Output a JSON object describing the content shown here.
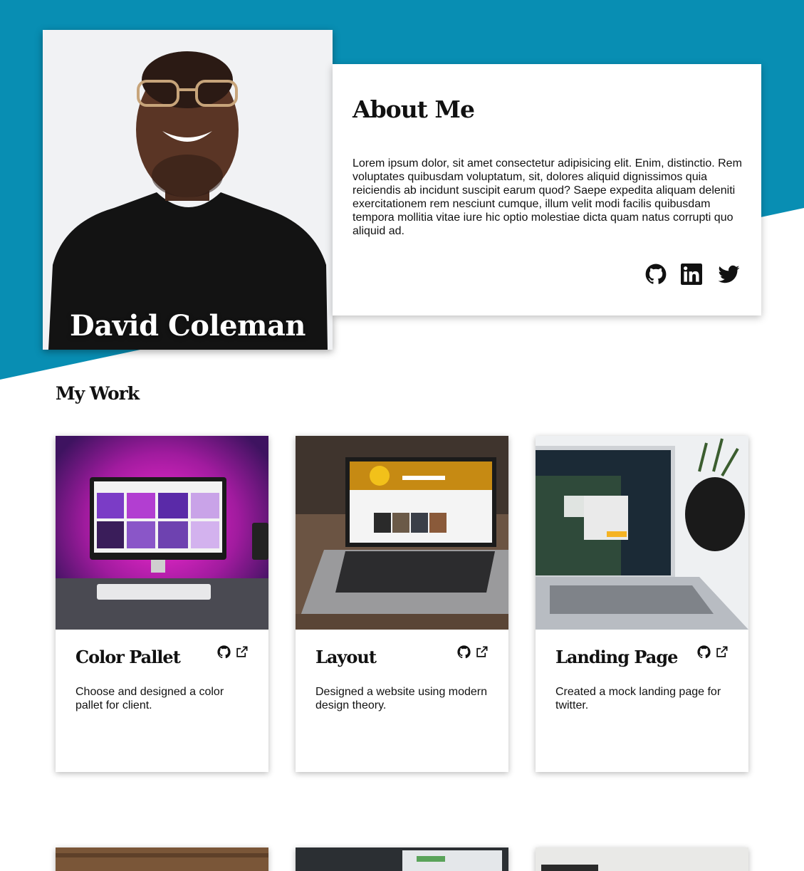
{
  "colors": {
    "hero_accent": "#088eb3",
    "text": "#111111",
    "card_bg": "#ffffff"
  },
  "profile": {
    "name": "David Coleman"
  },
  "about": {
    "title": "About Me",
    "text": "Lorem ipsum dolor, sit amet consectetur adipisicing elit. Enim, distinctio. Rem voluptates quibusdam voluptatum, sit, dolores aliquid dignissimos quia reiciendis ab incidunt suscipit earum quod? Saepe expedita aliquam deleniti exercitationem rem nesciunt cumque, illum velit modi facilis quibusdam tempora mollitia vitae iure hic optio molestiae dicta quam natus corrupti quo aliquid ad.",
    "socials": [
      "github-icon",
      "linkedin-icon",
      "twitter-icon"
    ]
  },
  "work": {
    "title": "My Work",
    "projects": [
      {
        "title": "Color Pallet",
        "description": "Choose and designed a color pallet for client.",
        "icons": [
          "github-icon",
          "external-link-icon"
        ]
      },
      {
        "title": "Layout",
        "description": "Designed a website using modern design theory.",
        "icons": [
          "github-icon",
          "external-link-icon"
        ]
      },
      {
        "title": "Landing Page",
        "description": "Created a mock landing page for twitter.",
        "icons": [
          "github-icon",
          "external-link-icon"
        ]
      }
    ]
  }
}
